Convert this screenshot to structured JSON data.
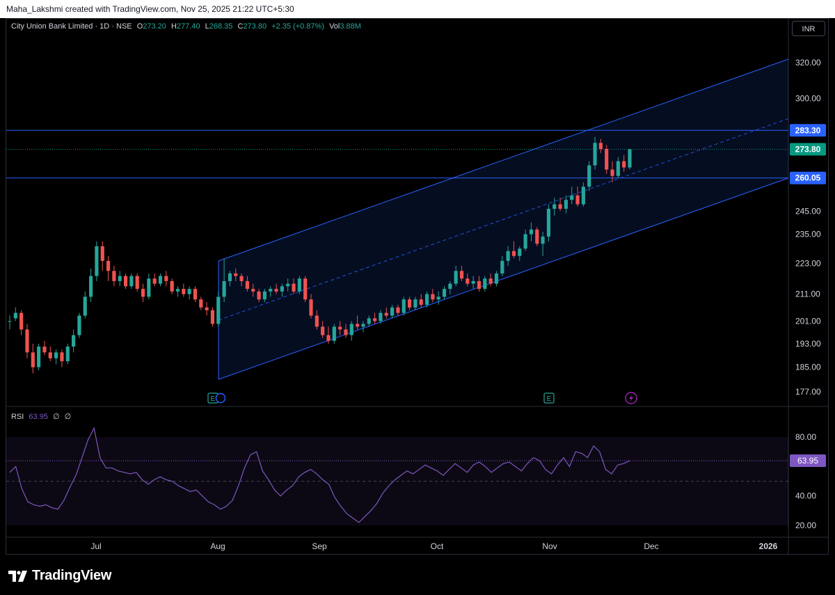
{
  "caption": "Maha_Lakshmi created with TradingView.com, Nov 25, 2025 21:22 UTC+5:30",
  "legend": {
    "symbol": "City Union Bank Limited · 1D · NSE",
    "o_label": "O",
    "o": "273.20",
    "h_label": "H",
    "h": "277.40",
    "l_label": "L",
    "l": "268.35",
    "c_label": "C",
    "c": "273.80",
    "change": "+2.35 (+0.87%)",
    "vol_label": "Vol",
    "vol": "3.88M"
  },
  "currency": "INR",
  "rsi_legend": {
    "name": "RSI",
    "value": "63.95",
    "z1": "∅",
    "z2": "∅"
  },
  "brand": "TradingView",
  "colors": {
    "up": "#26a69a",
    "down": "#ef5350",
    "channel": "#2962ff",
    "rsi": "#7e57c2"
  },
  "icons": [
    "earnings-icon",
    "dividend-icon",
    "earnings-icon",
    "flash-icon"
  ],
  "chart_data": {
    "type": "candlestick",
    "price_axis": {
      "ticks": [
        320,
        300,
        283.3,
        273.8,
        260.05,
        245,
        235,
        223,
        211,
        201,
        193,
        185,
        177
      ],
      "labels": [
        "320.00",
        "300.00",
        "283.30",
        "273.80",
        "260.05",
        "245.00",
        "235.00",
        "223.00",
        "211.00",
        "201.00",
        "193.00",
        "185.00",
        "177.00"
      ],
      "scale": "log"
    },
    "badges": [
      {
        "label": "283.30",
        "value": 283.3,
        "color": "#2962ff"
      },
      {
        "label": "273.80",
        "value": 273.8,
        "color": "#089981"
      },
      {
        "label": "260.05",
        "value": 260.05,
        "color": "#2962ff"
      }
    ],
    "horizontal_lines": [
      283.3,
      260.05
    ],
    "current_price": 273.8,
    "channel": {
      "start_date": "2025-08-01",
      "end_date": "2025-12-31",
      "lower_start": 181,
      "lower_end": 260,
      "upper_start": 224,
      "upper_end": 322
    },
    "time_axis": [
      "Jul",
      "Aug",
      "Sep",
      "Oct",
      "Nov",
      "Dec",
      "2026"
    ],
    "ohlc": [
      [
        201,
        203,
        198,
        201
      ],
      [
        202,
        206,
        201,
        204
      ],
      [
        204,
        205,
        196,
        198
      ],
      [
        198,
        200,
        188,
        190
      ],
      [
        190,
        193,
        183,
        185
      ],
      [
        185,
        193,
        184,
        192
      ],
      [
        192,
        194,
        189,
        190
      ],
      [
        190,
        192,
        187,
        188
      ],
      [
        188,
        191,
        186,
        190
      ],
      [
        190,
        191,
        185,
        187
      ],
      [
        187,
        193,
        186,
        192
      ],
      [
        192,
        198,
        190,
        196
      ],
      [
        196,
        204,
        195,
        203
      ],
      [
        203,
        212,
        202,
        210
      ],
      [
        210,
        221,
        208,
        218
      ],
      [
        218,
        232,
        216,
        230
      ],
      [
        230,
        232,
        220,
        224
      ],
      [
        224,
        226,
        216,
        220
      ],
      [
        220,
        222,
        214,
        216
      ],
      [
        216,
        220,
        214,
        218
      ],
      [
        218,
        219,
        213,
        214
      ],
      [
        214,
        219,
        213,
        218
      ],
      [
        218,
        219,
        212,
        213
      ],
      [
        213,
        215,
        208,
        210
      ],
      [
        210,
        219,
        209,
        217
      ],
      [
        217,
        219,
        214,
        215
      ],
      [
        215,
        219,
        214,
        218
      ],
      [
        218,
        220,
        214,
        216
      ],
      [
        216,
        217,
        211,
        212
      ],
      [
        212,
        214,
        210,
        213
      ],
      [
        213,
        215,
        210,
        211
      ],
      [
        211,
        214,
        209,
        213
      ],
      [
        213,
        214,
        208,
        209
      ],
      [
        209,
        210,
        205,
        206
      ],
      [
        206,
        208,
        203,
        205
      ],
      [
        205,
        206,
        199,
        200
      ],
      [
        200,
        212,
        199,
        210
      ],
      [
        210,
        225,
        208,
        216
      ],
      [
        216,
        220,
        214,
        219
      ],
      [
        219,
        221,
        216,
        218
      ],
      [
        218,
        219,
        214,
        216
      ],
      [
        216,
        218,
        212,
        213
      ],
      [
        213,
        215,
        210,
        212
      ],
      [
        212,
        213,
        208,
        209
      ],
      [
        209,
        213,
        208,
        212
      ],
      [
        212,
        214,
        210,
        213
      ],
      [
        213,
        215,
        211,
        212
      ],
      [
        212,
        215,
        210,
        214
      ],
      [
        214,
        217,
        212,
        215
      ],
      [
        215,
        217,
        211,
        212
      ],
      [
        212,
        218,
        211,
        217
      ],
      [
        217,
        218,
        208,
        209
      ],
      [
        209,
        211,
        202,
        203
      ],
      [
        203,
        205,
        198,
        199
      ],
      [
        199,
        201,
        195,
        196
      ],
      [
        196,
        199,
        193,
        194
      ],
      [
        194,
        200,
        193,
        199
      ],
      [
        199,
        201,
        196,
        198
      ],
      [
        198,
        200,
        195,
        196
      ],
      [
        196,
        201,
        194,
        200
      ],
      [
        200,
        203,
        198,
        199
      ],
      [
        199,
        201,
        197,
        200
      ],
      [
        200,
        203,
        199,
        202
      ],
      [
        202,
        204,
        200,
        201
      ],
      [
        201,
        205,
        200,
        204
      ],
      [
        204,
        206,
        202,
        203
      ],
      [
        203,
        207,
        202,
        206
      ],
      [
        206,
        207,
        203,
        204
      ],
      [
        204,
        210,
        203,
        209
      ],
      [
        209,
        210,
        205,
        206
      ],
      [
        206,
        210,
        205,
        209
      ],
      [
        209,
        211,
        206,
        207
      ],
      [
        207,
        212,
        206,
        211
      ],
      [
        211,
        213,
        208,
        209
      ],
      [
        209,
        212,
        207,
        210
      ],
      [
        210,
        214,
        209,
        213
      ],
      [
        213,
        216,
        211,
        215
      ],
      [
        215,
        222,
        214,
        220
      ],
      [
        220,
        222,
        216,
        217
      ],
      [
        217,
        219,
        214,
        215
      ],
      [
        215,
        218,
        213,
        216
      ],
      [
        216,
        218,
        212,
        213
      ],
      [
        213,
        218,
        212,
        217
      ],
      [
        217,
        219,
        214,
        215
      ],
      [
        215,
        220,
        214,
        219
      ],
      [
        219,
        226,
        218,
        224
      ],
      [
        224,
        230,
        222,
        228
      ],
      [
        228,
        232,
        225,
        226
      ],
      [
        226,
        230,
        224,
        229
      ],
      [
        229,
        237,
        228,
        235
      ],
      [
        235,
        240,
        232,
        237
      ],
      [
        237,
        238,
        230,
        231
      ],
      [
        231,
        236,
        226,
        234
      ],
      [
        234,
        248,
        232,
        246
      ],
      [
        246,
        251,
        243,
        248
      ],
      [
        248,
        251,
        245,
        246
      ],
      [
        246,
        252,
        244,
        250
      ],
      [
        250,
        256,
        248,
        252
      ],
      [
        252,
        256,
        247,
        248
      ],
      [
        248,
        258,
        247,
        256
      ],
      [
        256,
        268,
        254,
        266
      ],
      [
        266,
        280,
        264,
        277
      ],
      [
        277,
        279,
        272,
        274
      ],
      [
        274,
        276,
        262,
        264
      ],
      [
        264,
        268,
        258,
        261
      ],
      [
        261,
        270,
        260,
        268
      ],
      [
        268,
        271,
        263,
        265
      ],
      [
        265,
        274,
        264,
        273.8
      ]
    ],
    "rsi": {
      "ylim": [
        20,
        80
      ],
      "ticks": [
        "80.00",
        "63.95",
        "40.00",
        "20.00"
      ],
      "band": [
        30,
        70
      ],
      "midline": 50,
      "current": 63.95,
      "values": [
        56,
        60,
        45,
        36,
        34,
        33,
        34,
        32,
        31,
        37,
        46,
        54,
        66,
        78,
        86,
        66,
        59,
        59,
        57,
        56,
        55,
        56,
        51,
        48,
        51,
        53,
        51,
        50,
        47,
        45,
        43,
        44,
        40,
        36,
        34,
        31,
        33,
        37,
        47,
        59,
        68,
        70,
        57,
        51,
        44,
        40,
        44,
        47,
        53,
        56,
        58,
        55,
        51,
        48,
        39,
        33,
        28,
        25,
        22,
        26,
        30,
        35,
        42,
        47,
        51,
        54,
        57,
        55,
        58,
        61,
        59,
        57,
        54,
        58,
        62,
        59,
        56,
        61,
        63,
        60,
        56,
        59,
        62,
        63,
        60,
        57,
        62,
        66,
        64,
        58,
        55,
        61,
        66,
        60,
        70,
        69,
        66,
        74,
        70,
        58,
        55,
        61,
        62,
        63.95
      ]
    }
  }
}
